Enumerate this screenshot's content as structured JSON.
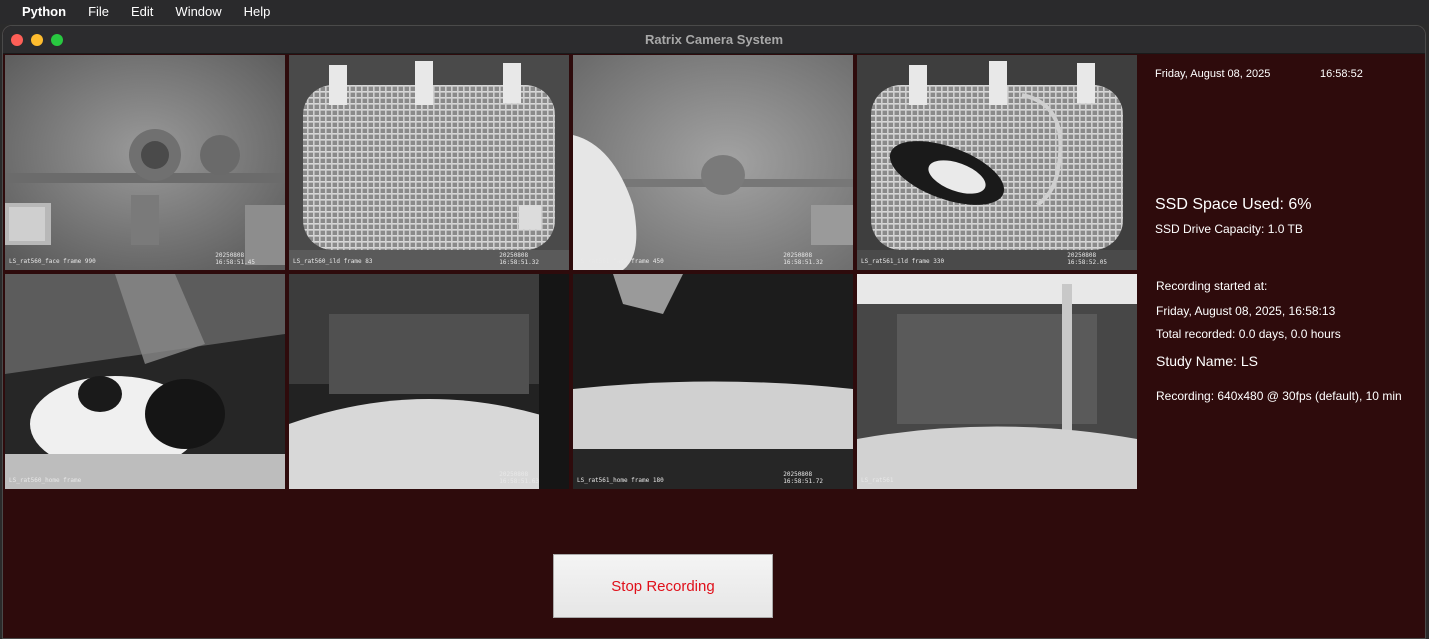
{
  "menubar": {
    "app": "Python",
    "items": [
      "File",
      "Edit",
      "Window",
      "Help"
    ]
  },
  "window": {
    "title": "Ratrix Camera System"
  },
  "cameras": [
    {
      "label": "LS_rat560_face frame 990",
      "date": "20250808",
      "time": "16:58:51.45"
    },
    {
      "label": "LS_rat560_ild frame 83",
      "date": "20250808",
      "time": "16:58:51.32"
    },
    {
      "label": "LS_rat561_face frame 450",
      "date": "20250808",
      "time": "16:58:51.32"
    },
    {
      "label": "LS_rat561_ild frame 330",
      "date": "20250808",
      "time": "16:58:52.05"
    },
    {
      "label": "LS_rat560_home frame",
      "date": "",
      "time": ""
    },
    {
      "label": "",
      "date": "20250808",
      "time": "16:58:51.63"
    },
    {
      "label": "LS_rat561_home frame 180",
      "date": "20250808",
      "time": "16:58:51.72"
    },
    {
      "label": "LS_rat561",
      "date": "",
      "time": ""
    }
  ],
  "info": {
    "date": "Friday, August 08, 2025",
    "time": "16:58:52",
    "ssd_used": "SSD Space Used: 6%",
    "ssd_capacity": "SSD Drive Capacity: 1.0 TB",
    "recording_started_label": "Recording started at:",
    "recording_started": "Friday, August 08, 2025, 16:58:13",
    "total_recorded": "Total recorded: 0.0 days, 0.0 hours",
    "study_name": "Study Name: LS",
    "recording_settings": "Recording: 640x480 @ 30fps (default), 10 min"
  },
  "controls": {
    "stop_label": "Stop Recording"
  },
  "colors": {
    "window_bg": "#2e0b0c",
    "stop_text": "#e0101a"
  }
}
